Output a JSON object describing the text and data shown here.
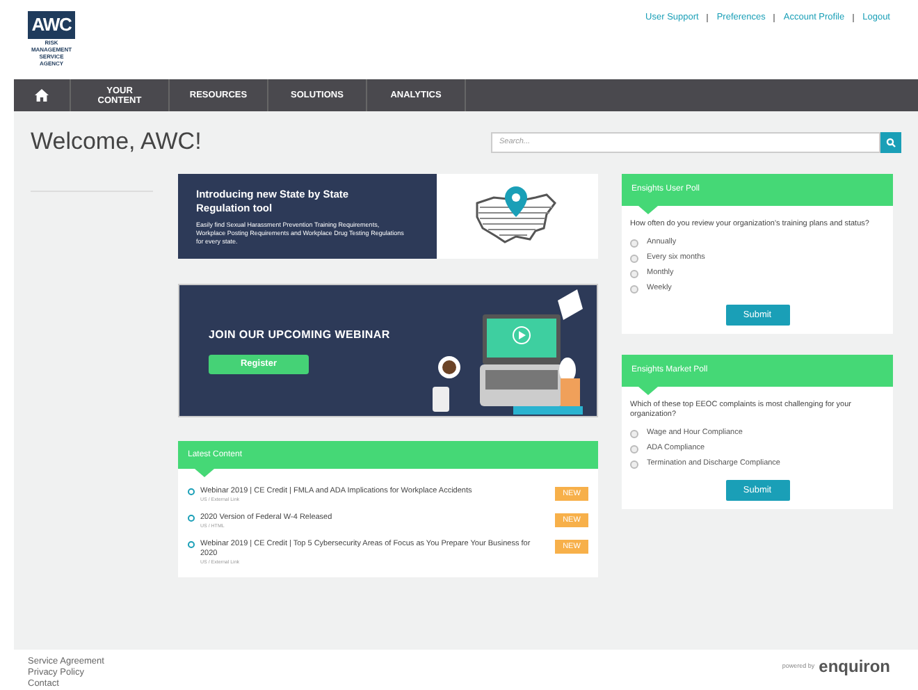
{
  "header": {
    "logo": {
      "main": "AWC",
      "lines": [
        "RISK",
        "MANAGEMENT",
        "SERVICE",
        "AGENCY"
      ]
    },
    "links": [
      "User Support",
      "Preferences",
      "Account Profile",
      "Logout"
    ]
  },
  "nav": {
    "items": [
      "YOUR CONTENT",
      "RESOURCES",
      "SOLUTIONS",
      "ANALYTICS"
    ]
  },
  "welcome": "Welcome, AWC!",
  "search": {
    "placeholder": "Search..."
  },
  "banners": [
    {
      "kind": "map",
      "title": "Introducing new State by State Regulation tool",
      "text": "Easily find Sexual Harassment Prevention Training Requirements, Workplace Posting Requirements and Workplace Drug Testing Regulations for every state."
    },
    {
      "kind": "webinar",
      "title": "JOIN OUR UPCOMING WEBINAR",
      "button": "Register"
    }
  ],
  "latest": {
    "title": "Latest Content",
    "items": [
      {
        "title": "Webinar 2019 | CE Credit | FMLA and ADA Implications for Workplace Accidents",
        "meta": "US / External Link",
        "badge": "NEW"
      },
      {
        "title": "2020 Version of Federal W-4 Released",
        "meta": "US / HTML",
        "badge": "NEW"
      },
      {
        "title": "Webinar 2019 | CE Credit | Top 5 Cybersecurity Areas of Focus as You Prepare Your Business for 2020",
        "meta": "US / External Link",
        "badge": "NEW"
      }
    ]
  },
  "polls": [
    {
      "title": "Ensights User Poll",
      "question": "How often do you review your organization's training plans and status?",
      "options": [
        {
          "label": "Annually",
          "selected": false
        },
        {
          "label": "Every six months",
          "selected": false
        },
        {
          "label": "Monthly",
          "selected": false
        },
        {
          "label": "Weekly",
          "selected": false
        }
      ],
      "button": "Submit"
    },
    {
      "title": "Ensights Market Poll",
      "question": "Which of these top EEOC complaints is most challenging for your organization?",
      "options": [
        {
          "label": "Wage and Hour Compliance",
          "selected": false
        },
        {
          "label": "ADA Compliance",
          "selected": false
        },
        {
          "label": "Termination and Discharge Compliance",
          "selected": false
        }
      ],
      "button": "Submit"
    }
  ],
  "footer": {
    "links": [
      "Service Agreement",
      "Privacy Policy",
      "Contact"
    ],
    "powered_by": "powered by",
    "brand": "enquiron"
  }
}
